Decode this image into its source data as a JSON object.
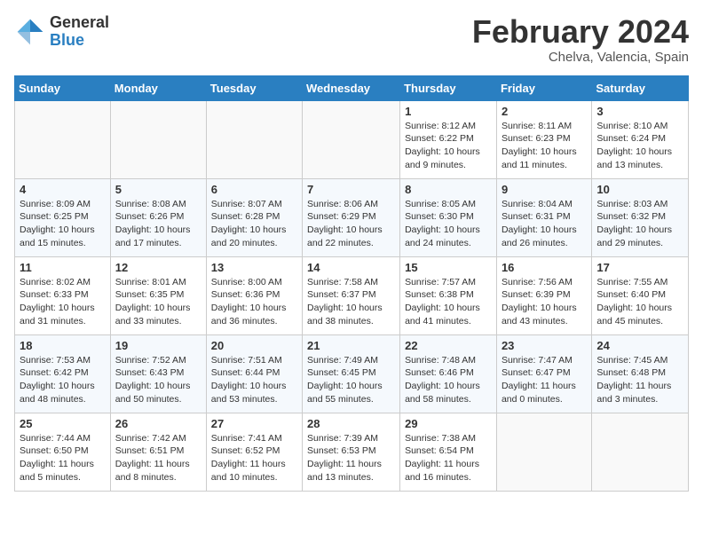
{
  "header": {
    "logo_general": "General",
    "logo_blue": "Blue",
    "month_title": "February 2024",
    "location": "Chelva, Valencia, Spain"
  },
  "days_of_week": [
    "Sunday",
    "Monday",
    "Tuesday",
    "Wednesday",
    "Thursday",
    "Friday",
    "Saturday"
  ],
  "weeks": [
    [
      {
        "day": "",
        "info": ""
      },
      {
        "day": "",
        "info": ""
      },
      {
        "day": "",
        "info": ""
      },
      {
        "day": "",
        "info": ""
      },
      {
        "day": "1",
        "info": "Sunrise: 8:12 AM\nSunset: 6:22 PM\nDaylight: 10 hours and 9 minutes."
      },
      {
        "day": "2",
        "info": "Sunrise: 8:11 AM\nSunset: 6:23 PM\nDaylight: 10 hours and 11 minutes."
      },
      {
        "day": "3",
        "info": "Sunrise: 8:10 AM\nSunset: 6:24 PM\nDaylight: 10 hours and 13 minutes."
      }
    ],
    [
      {
        "day": "4",
        "info": "Sunrise: 8:09 AM\nSunset: 6:25 PM\nDaylight: 10 hours and 15 minutes."
      },
      {
        "day": "5",
        "info": "Sunrise: 8:08 AM\nSunset: 6:26 PM\nDaylight: 10 hours and 17 minutes."
      },
      {
        "day": "6",
        "info": "Sunrise: 8:07 AM\nSunset: 6:28 PM\nDaylight: 10 hours and 20 minutes."
      },
      {
        "day": "7",
        "info": "Sunrise: 8:06 AM\nSunset: 6:29 PM\nDaylight: 10 hours and 22 minutes."
      },
      {
        "day": "8",
        "info": "Sunrise: 8:05 AM\nSunset: 6:30 PM\nDaylight: 10 hours and 24 minutes."
      },
      {
        "day": "9",
        "info": "Sunrise: 8:04 AM\nSunset: 6:31 PM\nDaylight: 10 hours and 26 minutes."
      },
      {
        "day": "10",
        "info": "Sunrise: 8:03 AM\nSunset: 6:32 PM\nDaylight: 10 hours and 29 minutes."
      }
    ],
    [
      {
        "day": "11",
        "info": "Sunrise: 8:02 AM\nSunset: 6:33 PM\nDaylight: 10 hours and 31 minutes."
      },
      {
        "day": "12",
        "info": "Sunrise: 8:01 AM\nSunset: 6:35 PM\nDaylight: 10 hours and 33 minutes."
      },
      {
        "day": "13",
        "info": "Sunrise: 8:00 AM\nSunset: 6:36 PM\nDaylight: 10 hours and 36 minutes."
      },
      {
        "day": "14",
        "info": "Sunrise: 7:58 AM\nSunset: 6:37 PM\nDaylight: 10 hours and 38 minutes."
      },
      {
        "day": "15",
        "info": "Sunrise: 7:57 AM\nSunset: 6:38 PM\nDaylight: 10 hours and 41 minutes."
      },
      {
        "day": "16",
        "info": "Sunrise: 7:56 AM\nSunset: 6:39 PM\nDaylight: 10 hours and 43 minutes."
      },
      {
        "day": "17",
        "info": "Sunrise: 7:55 AM\nSunset: 6:40 PM\nDaylight: 10 hours and 45 minutes."
      }
    ],
    [
      {
        "day": "18",
        "info": "Sunrise: 7:53 AM\nSunset: 6:42 PM\nDaylight: 10 hours and 48 minutes."
      },
      {
        "day": "19",
        "info": "Sunrise: 7:52 AM\nSunset: 6:43 PM\nDaylight: 10 hours and 50 minutes."
      },
      {
        "day": "20",
        "info": "Sunrise: 7:51 AM\nSunset: 6:44 PM\nDaylight: 10 hours and 53 minutes."
      },
      {
        "day": "21",
        "info": "Sunrise: 7:49 AM\nSunset: 6:45 PM\nDaylight: 10 hours and 55 minutes."
      },
      {
        "day": "22",
        "info": "Sunrise: 7:48 AM\nSunset: 6:46 PM\nDaylight: 10 hours and 58 minutes."
      },
      {
        "day": "23",
        "info": "Sunrise: 7:47 AM\nSunset: 6:47 PM\nDaylight: 11 hours and 0 minutes."
      },
      {
        "day": "24",
        "info": "Sunrise: 7:45 AM\nSunset: 6:48 PM\nDaylight: 11 hours and 3 minutes."
      }
    ],
    [
      {
        "day": "25",
        "info": "Sunrise: 7:44 AM\nSunset: 6:50 PM\nDaylight: 11 hours and 5 minutes."
      },
      {
        "day": "26",
        "info": "Sunrise: 7:42 AM\nSunset: 6:51 PM\nDaylight: 11 hours and 8 minutes."
      },
      {
        "day": "27",
        "info": "Sunrise: 7:41 AM\nSunset: 6:52 PM\nDaylight: 11 hours and 10 minutes."
      },
      {
        "day": "28",
        "info": "Sunrise: 7:39 AM\nSunset: 6:53 PM\nDaylight: 11 hours and 13 minutes."
      },
      {
        "day": "29",
        "info": "Sunrise: 7:38 AM\nSunset: 6:54 PM\nDaylight: 11 hours and 16 minutes."
      },
      {
        "day": "",
        "info": ""
      },
      {
        "day": "",
        "info": ""
      }
    ]
  ]
}
